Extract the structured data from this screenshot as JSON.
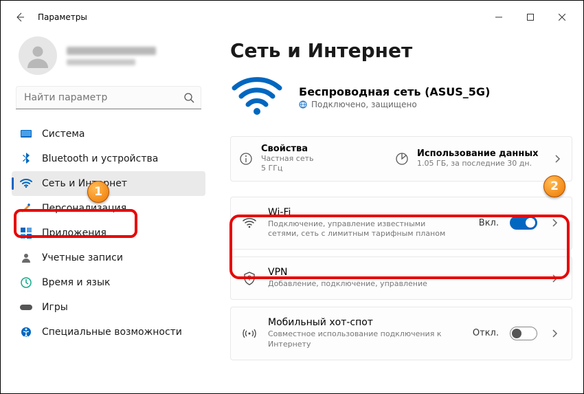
{
  "header": {
    "title": "Параметры"
  },
  "search": {
    "placeholder": "Найти параметр"
  },
  "sidebar": {
    "items": [
      {
        "label": "Система"
      },
      {
        "label": "Bluetooth и устройства"
      },
      {
        "label": "Сеть и Интернет"
      },
      {
        "label": "Персонализация"
      },
      {
        "label": "Приложения"
      },
      {
        "label": "Учетные записи"
      },
      {
        "label": "Время и язык"
      },
      {
        "label": "Игры"
      },
      {
        "label": "Специальные возможности"
      }
    ]
  },
  "main": {
    "title": "Сеть и Интернет",
    "hero": {
      "title": "Беспроводная сеть (ASUS_5G)",
      "subtitle": "Подключено, защищено"
    },
    "quick": {
      "props": {
        "title": "Свойства",
        "sub": "Частная сеть\n5 ГГц"
      },
      "usage": {
        "title": "Использование данных",
        "sub": "1.05 ГБ, за последние 30 дн."
      }
    },
    "cards": {
      "wifi": {
        "title": "Wi-Fi",
        "sub": "Подключение, управление известными сетями, сеть с лимитным тарифным планом",
        "state": "Вкл."
      },
      "vpn": {
        "title": "VPN",
        "sub": "Добавление, подключение, управление"
      },
      "hotspot": {
        "title": "Мобильный хот-спот",
        "sub": "Совместное использование подключения к Интернету",
        "state": "Откл."
      }
    }
  },
  "markers": {
    "one": "1",
    "two": "2"
  }
}
